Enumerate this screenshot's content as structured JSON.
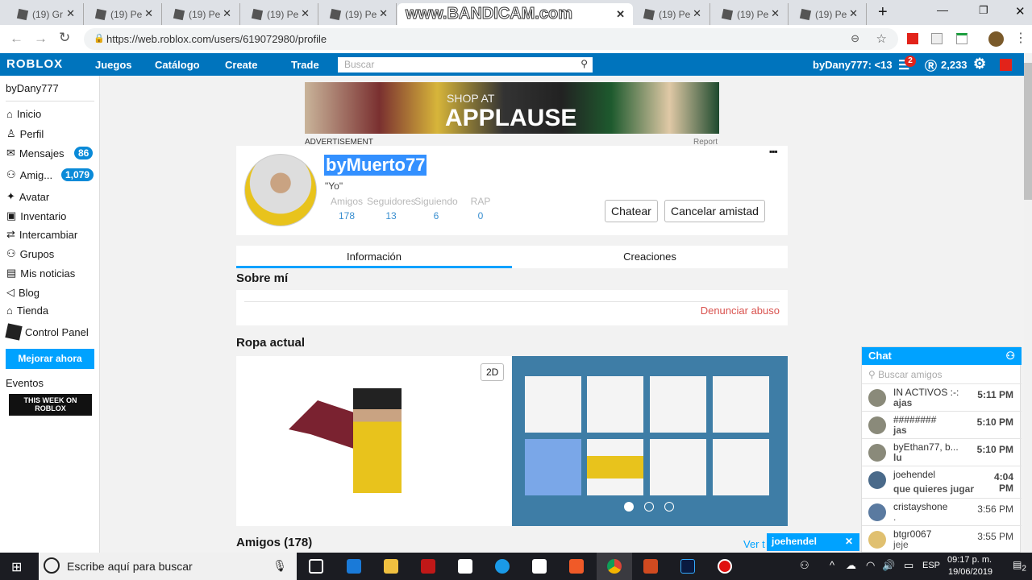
{
  "browser": {
    "tabs": [
      "(19) Gr",
      "(19) Pe",
      "(19) Pe",
      "(19) Pe",
      "(19) Pe",
      "www.BANDICAM.com",
      "(19) Pe",
      "(19) Pe",
      "(19) Pe"
    ],
    "url": "https://web.roblox.com/users/619072980/profile"
  },
  "nav": {
    "logo": "ROBLOX",
    "links": [
      "Juegos",
      "Catálogo",
      "Create",
      "Trade"
    ],
    "search_placeholder": "Buscar",
    "user": "byDany777: <13",
    "notifications": "2",
    "robux": "2,233"
  },
  "sidebar": {
    "username": "byDany777",
    "items": [
      {
        "label": "Inicio"
      },
      {
        "label": "Perfil"
      },
      {
        "label": "Mensajes",
        "badge": "86"
      },
      {
        "label": "Amig...",
        "badge": "1,079"
      },
      {
        "label": "Avatar"
      },
      {
        "label": "Inventario"
      },
      {
        "label": "Intercambiar"
      },
      {
        "label": "Grupos"
      },
      {
        "label": "Mis noticias"
      },
      {
        "label": "Blog"
      },
      {
        "label": "Tienda"
      },
      {
        "label": "Control Panel"
      }
    ],
    "upgrade": "Mejorar ahora",
    "events": "Eventos",
    "event_banner": "THIS WEEK ON ROBLOX"
  },
  "ad": {
    "label": "ADVERTISEMENT",
    "report": "Report",
    "text_top": "SHOP AT",
    "text_main": "APPLAUSE"
  },
  "profile": {
    "name": "byMuerto77",
    "status": "\"Yo\"",
    "stats": [
      {
        "label": "Amigos",
        "value": "178"
      },
      {
        "label": "Seguidores",
        "value": "13"
      },
      {
        "label": "Siguiendo",
        "value": "6"
      },
      {
        "label": "RAP",
        "value": "0"
      }
    ],
    "chat_btn": "Chatear",
    "unfriend_btn": "Cancelar amistad"
  },
  "tabs": [
    "Información",
    "Creaciones"
  ],
  "about": {
    "title": "Sobre mí",
    "report": "Denunciar abuso"
  },
  "outfit": {
    "title": "Ropa actual",
    "toggle": "2D"
  },
  "friends": {
    "title": "Amigos (178)",
    "see_all": "Ver t"
  },
  "chat": {
    "title": "Chat",
    "search": "Buscar amigos",
    "rows": [
      {
        "name": "IN ACTIVOS :-:",
        "msg": "ajas",
        "time": "5:11 PM"
      },
      {
        "name": "########",
        "msg": "jas",
        "time": "5:10 PM"
      },
      {
        "name": "byEthan77, b...",
        "msg": "lu",
        "time": "5:10 PM"
      },
      {
        "name": "joehendel",
        "msg": "que quieres jugar",
        "time": "4:04 PM"
      },
      {
        "name": "cristayshone",
        "msg": ".",
        "time": "3:56 PM"
      },
      {
        "name": "btgr0067",
        "msg": "jeje",
        "time": "3:55 PM"
      }
    ],
    "open_window": "joehendel"
  },
  "taskbar": {
    "search": "Escribe aquí para buscar",
    "lang": "ESP",
    "time": "09:17 p. m.",
    "date": "19/06/2019",
    "notif": "2"
  },
  "colors": {
    "roblox_blue": "#0074bd",
    "accent": "#00a2ff",
    "outfit_bg": "#3e7da6"
  }
}
